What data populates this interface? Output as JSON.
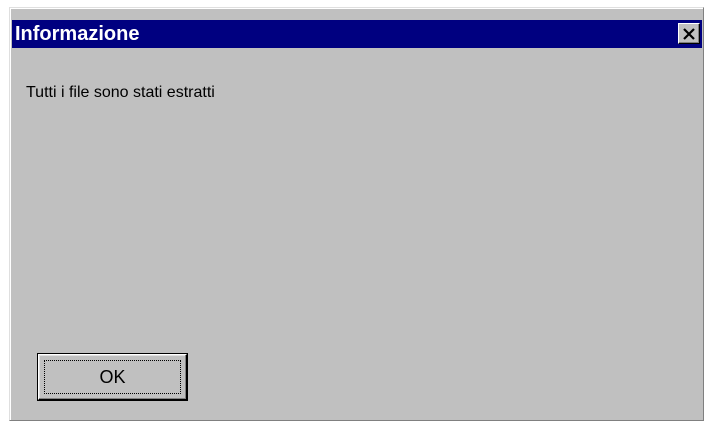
{
  "dialog": {
    "title": "Informazione",
    "close_icon": "close-icon",
    "message": "Tutti i file sono stati estratti",
    "ok_label": "OK"
  },
  "colors": {
    "titlebar": "#000080",
    "dialog_face": "#c0c0c0",
    "title_text": "#ffffff"
  }
}
